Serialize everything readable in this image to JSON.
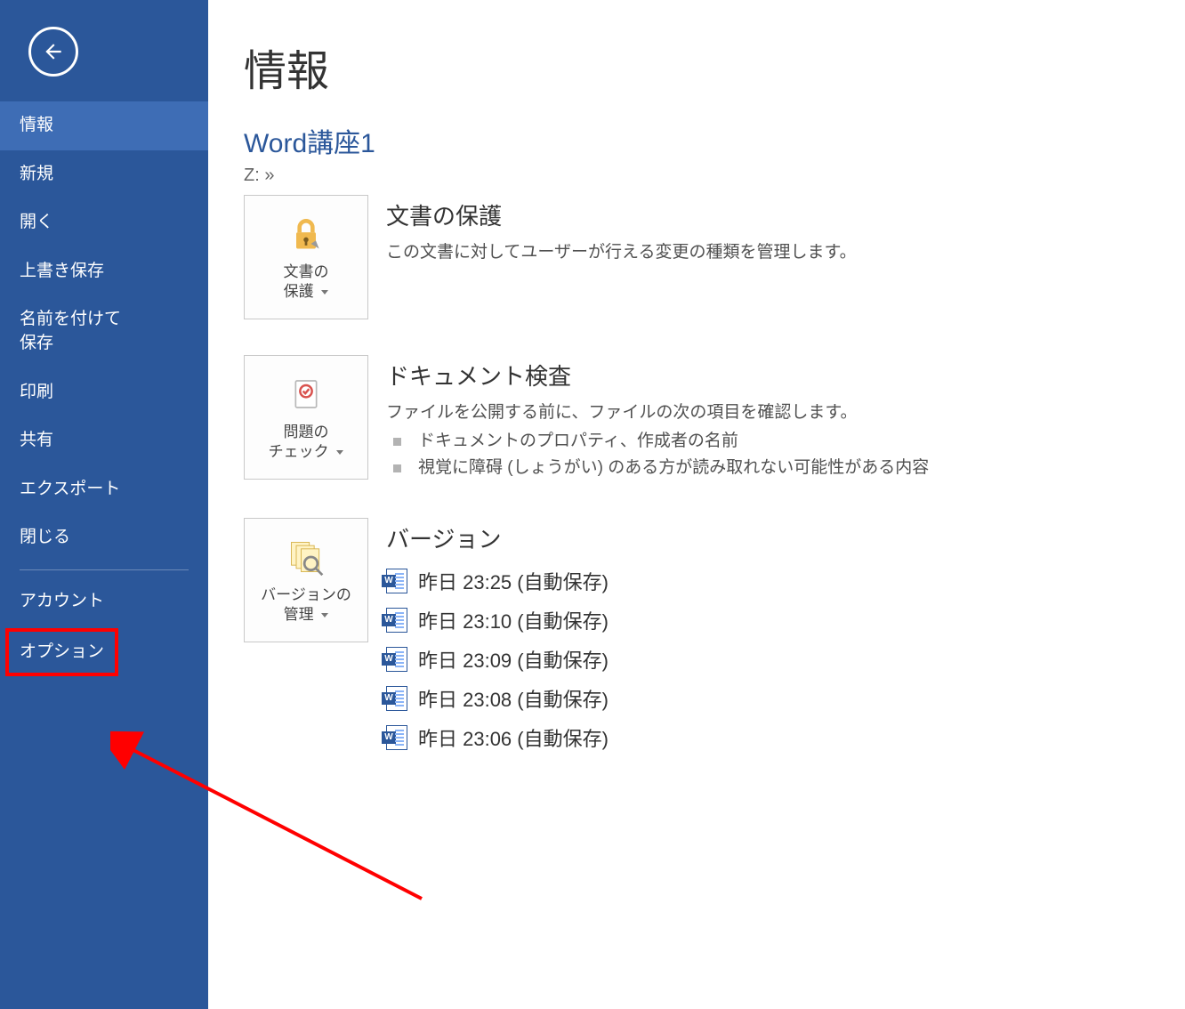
{
  "sidebar": {
    "items": [
      {
        "label": "情報",
        "active": true
      },
      {
        "label": "新規"
      },
      {
        "label": "開く"
      },
      {
        "label": "上書き保存"
      },
      {
        "label": "名前を付けて\n保存"
      },
      {
        "label": "印刷"
      },
      {
        "label": "共有"
      },
      {
        "label": "エクスポート"
      },
      {
        "label": "閉じる"
      }
    ],
    "account": "アカウント",
    "options": "オプション"
  },
  "main": {
    "page_title": "情報",
    "doc_title": "Word講座1",
    "doc_path": "Z: »",
    "protect": {
      "tile_label": "文書の\n保護",
      "heading": "文書の保護",
      "desc": "この文書に対してユーザーが行える変更の種類を管理します。"
    },
    "inspect": {
      "tile_label": "問題の\nチェック",
      "heading": "ドキュメント検査",
      "desc": "ファイルを公開する前に、ファイルの次の項目を確認します。",
      "bullets": [
        "ドキュメントのプロパティ、作成者の名前",
        "視覚に障碍 (しょうがい) のある方が読み取れない可能性がある内容"
      ]
    },
    "versions": {
      "tile_label": "バージョンの\n管理",
      "heading": "バージョン",
      "items": [
        "昨日 23:25 (自動保存)",
        "昨日 23:10 (自動保存)",
        "昨日 23:09 (自動保存)",
        "昨日 23:08 (自動保存)",
        "昨日 23:06 (自動保存)"
      ]
    }
  }
}
